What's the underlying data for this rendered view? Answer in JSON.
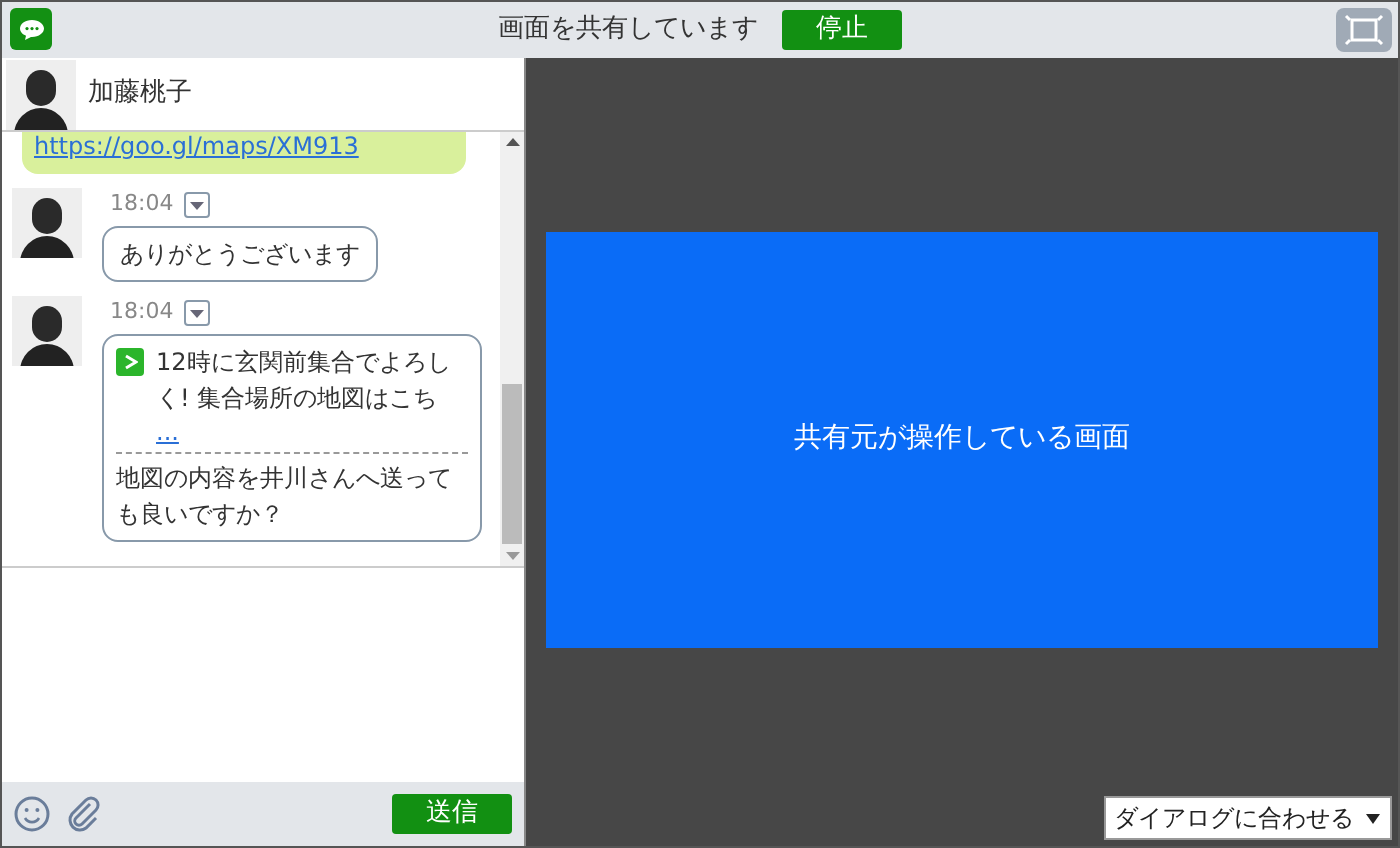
{
  "topbar": {
    "status": "画面を共有しています",
    "stop_button": "停止"
  },
  "chat": {
    "contact": "加藤桃子",
    "messages": [
      {
        "kind": "link",
        "text": "https://goo.gl/maps/XM913"
      },
      {
        "kind": "text",
        "time": "18:04",
        "text": "ありがとうございます"
      },
      {
        "kind": "share",
        "time": "18:04",
        "preview": "12時に玄関前集合でよろしく! 集合場所の地図はこち",
        "more": "...",
        "text": "地図の内容を井川さんへ送っても良いですか？"
      }
    ],
    "send_button": "送信"
  },
  "shared_screen": {
    "caption": "共有元が操作している画面"
  },
  "fit_select": {
    "value": "ダイアログに合わせる"
  }
}
